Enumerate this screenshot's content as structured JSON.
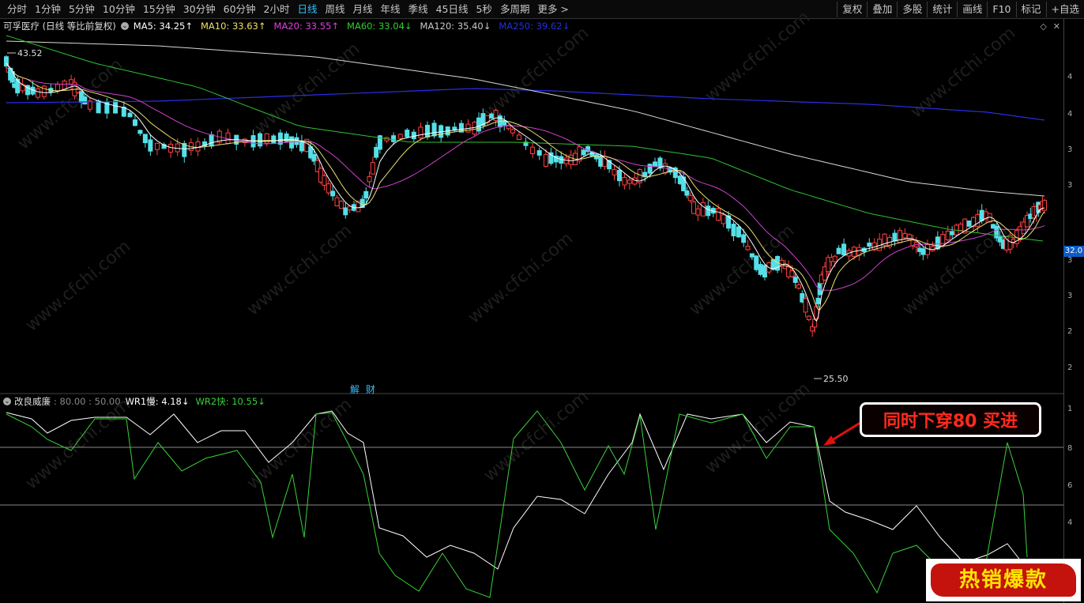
{
  "toolbar": {
    "periods": [
      "分时",
      "1分钟",
      "5分钟",
      "10分钟",
      "15分钟",
      "30分钟",
      "60分钟",
      "2小时",
      "日线",
      "周线",
      "月线",
      "年线",
      "季线",
      "45日线",
      "5秒",
      "多周期",
      "更多 >"
    ],
    "active_period": "日线",
    "tools": [
      "复权",
      "叠加",
      "多股",
      "统计",
      "画线",
      "F10",
      "标记",
      "+自选"
    ]
  },
  "main_chart": {
    "title": "可孚医疗 (日线 等比前复权)",
    "ma": [
      {
        "label": "MA5: 34.25↑",
        "color": "#ffffff"
      },
      {
        "label": "MA10: 33.63↑",
        "color": "#f0e060"
      },
      {
        "label": "MA20: 33.55↑",
        "color": "#e040e0"
      },
      {
        "label": "MA60: 33.04↓",
        "color": "#30d030"
      },
      {
        "label": "MA120: 35.40↓",
        "color": "#c8c8c8"
      },
      {
        "label": "MA250: 39.62↓",
        "color": "#2030e0"
      }
    ],
    "high_label": "43.52",
    "low_label": "25.50",
    "current_price": "32.0",
    "axis_ticks": [
      "4",
      "4",
      "3",
      "3",
      "3",
      "3",
      "2",
      "2"
    ],
    "bottom_tags": "解 财"
  },
  "indicator": {
    "name": "改良威廉",
    "params": ": 80.00 : 50.00",
    "wr1": "WR1慢: 4.18↓",
    "wr2": "WR2快: 10.55↓",
    "axis_ticks": [
      "1",
      "8",
      "6",
      "4"
    ],
    "callout": "同时下穿80 买进",
    "badge": "热销爆款"
  },
  "watermark": "www.cfchi.com"
}
